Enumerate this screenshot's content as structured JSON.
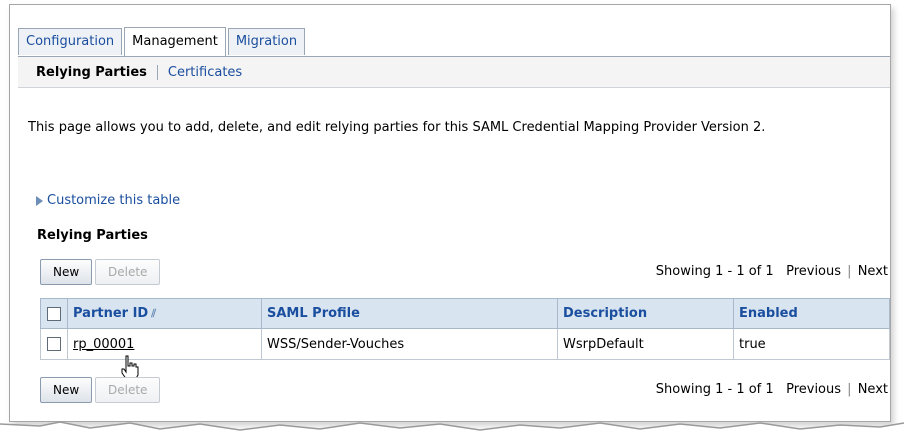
{
  "tabs": [
    {
      "label": "Configuration",
      "active": false
    },
    {
      "label": "Management",
      "active": true
    },
    {
      "label": "Migration",
      "active": false
    }
  ],
  "subtabs": [
    {
      "label": "Relying Parties",
      "active": true
    },
    {
      "label": "Certificates",
      "active": false
    }
  ],
  "description": "This page allows you to add, delete, and edit relying parties for this SAML Credential Mapping Provider Version 2.",
  "customize_label": "Customize this table",
  "section_title": "Relying Parties",
  "toolbar": {
    "new_label": "New",
    "delete_label": "Delete",
    "showing": "Showing 1 - 1 of 1",
    "previous": "Previous",
    "separator": "|",
    "next": "Next"
  },
  "table": {
    "headers": [
      "Partner ID",
      "SAML Profile",
      "Description",
      "Enabled"
    ],
    "rows": [
      {
        "partner_id": "rp_00001",
        "saml_profile": "WSS/Sender-Vouches",
        "description": "WsrpDefault",
        "enabled": "true"
      }
    ]
  },
  "colors": {
    "link": "#1a4e9e",
    "header_bg": "#d9e4f1"
  }
}
